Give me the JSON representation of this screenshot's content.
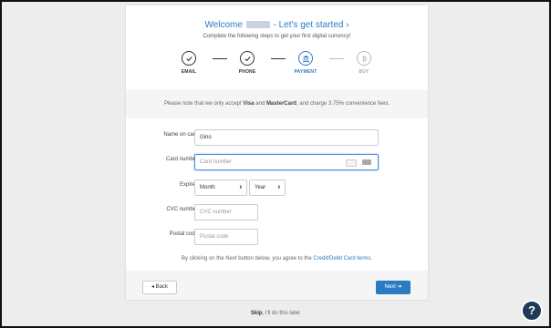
{
  "header": {
    "welcome_prefix": "Welcome",
    "welcome_suffix": "- Let's get started ›",
    "subtitle": "Complete the following steps to get your first digital currency!"
  },
  "steps": [
    {
      "label": "EMAIL",
      "state": "done",
      "icon": "check-icon"
    },
    {
      "label": "PHONE",
      "state": "done",
      "icon": "check-icon"
    },
    {
      "label": "PAYMENT",
      "state": "active",
      "icon": "bank-icon"
    },
    {
      "label": "BUY",
      "state": "inactive",
      "icon": "bitcoin-icon"
    }
  ],
  "notice": {
    "pre": "Please note that we only accept ",
    "visa": "Visa",
    "and": " and ",
    "mastercard": "MasterCard",
    "post": ", and charge 3.75% convenience fees."
  },
  "form": {
    "name_label": "Name on card",
    "name_value": "Gino",
    "card_label": "Card number",
    "card_placeholder": "Card number",
    "expires_label": "Expires",
    "month_value": "Month",
    "year_value": "Year",
    "cvc_label": "CVC number",
    "cvc_placeholder": "CVC number",
    "postal_label": "Postal code",
    "postal_placeholder": "Postal code"
  },
  "agreement": {
    "pre": "By clicking on the Next button below, you agree to the ",
    "link": "Credit/Debit Card terms",
    "post": "."
  },
  "footer": {
    "back_label": "◂ Back",
    "next_label": "Next ➔"
  },
  "skip": {
    "bold": "Skip",
    "rest": ", I'll do this later"
  },
  "help": {
    "label": "?"
  },
  "colors": {
    "accent": "#2b7bc2",
    "help_bg": "#1e3b5a"
  }
}
